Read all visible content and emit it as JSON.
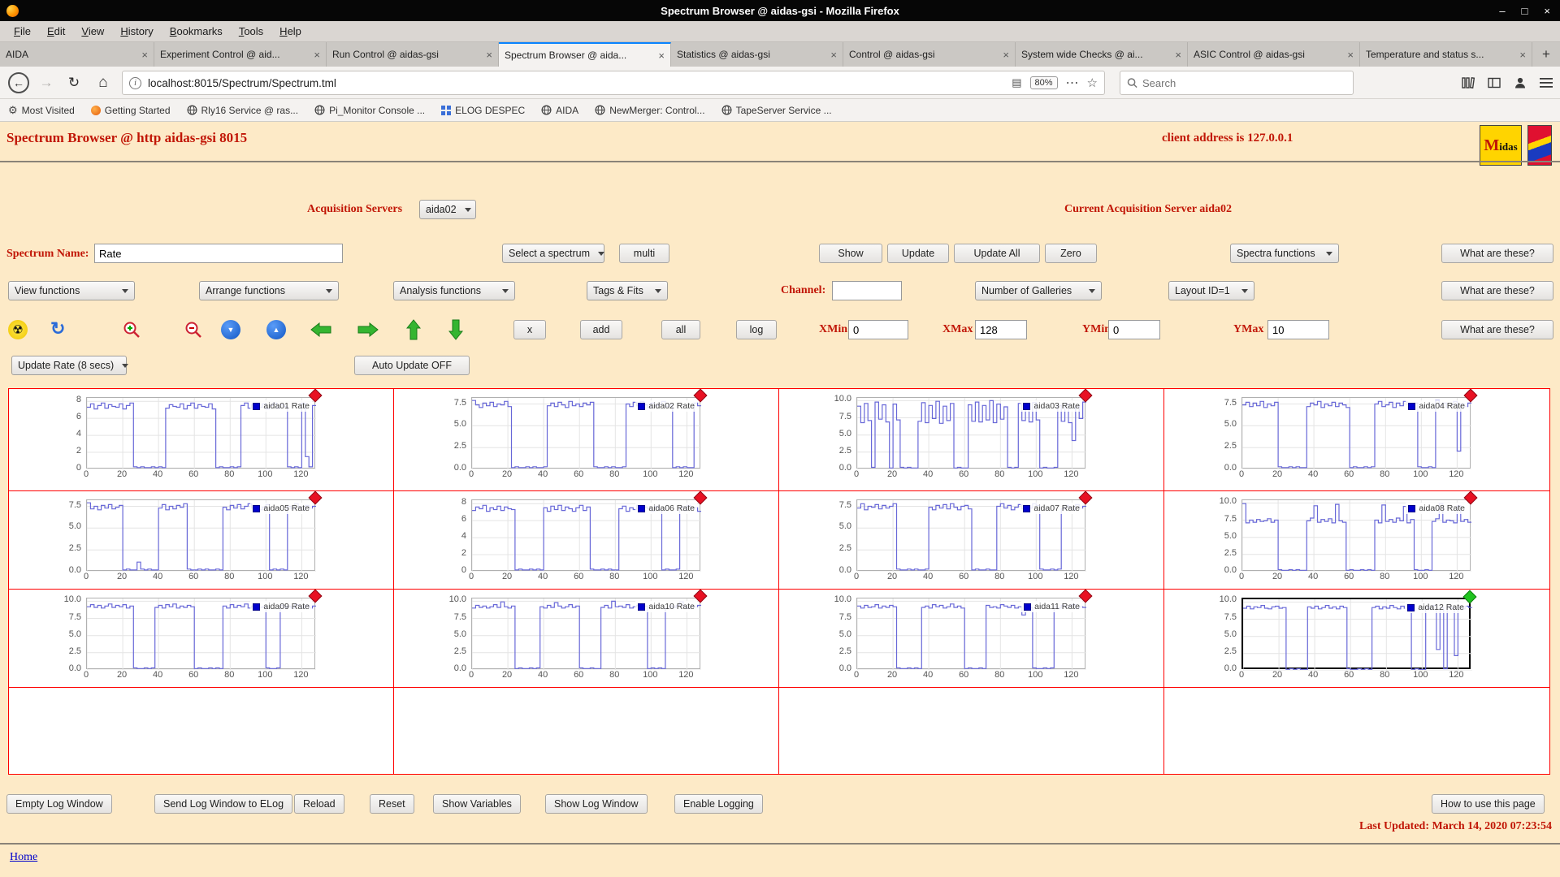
{
  "window": {
    "title": "Spectrum Browser @ aidas-gsi - Mozilla Firefox"
  },
  "menubar": [
    "File",
    "Edit",
    "View",
    "History",
    "Bookmarks",
    "Tools",
    "Help"
  ],
  "tabs": [
    {
      "label": "AIDA"
    },
    {
      "label": "Experiment Control @ aid..."
    },
    {
      "label": "Run Control @ aidas-gsi"
    },
    {
      "label": "Spectrum Browser @ aida...",
      "active": true
    },
    {
      "label": "Statistics @ aidas-gsi"
    },
    {
      "label": "Control @ aidas-gsi"
    },
    {
      "label": "System wide Checks @ ai..."
    },
    {
      "label": "ASIC Control @ aidas-gsi"
    },
    {
      "label": "Temperature and status s..."
    }
  ],
  "navbar": {
    "url": "localhost:8015/Spectrum/Spectrum.tml",
    "zoom": "80%",
    "search_placeholder": "Search"
  },
  "bookmarks": [
    "Most Visited",
    "Getting Started",
    "Rly16 Service @ ras...",
    "Pi_Monitor Console ...",
    "ELOG DESPEC",
    "AIDA",
    "NewMerger: Control...",
    "TapeServer Service ..."
  ],
  "page": {
    "title": "Spectrum Browser @ http aidas-gsi 8015",
    "client_address": "client address is 127.0.0.1",
    "midas_logo_text": "Midas",
    "acquisition_servers_label": "Acquisition Servers",
    "acquisition_server_value": "aida02",
    "current_server": "Current Acquisition Server aida02",
    "spectrum_name_label": "Spectrum Name:",
    "spectrum_name_value": "Rate",
    "select_spectrum": "Select a spectrum",
    "multi": "multi",
    "show": "Show",
    "update": "Update",
    "update_all": "Update All",
    "zero": "Zero",
    "spectra_functions": "Spectra functions",
    "what_are_these": "What are these?",
    "view_functions": "View functions",
    "arrange_functions": "Arrange functions",
    "analysis_functions": "Analysis functions",
    "tags_fits": "Tags & Fits",
    "channel_label": "Channel:",
    "number_of_galleries": "Number of Galleries",
    "layout_id": "Layout ID=1",
    "x_label": "x",
    "add_label": "add",
    "all_label": "all",
    "log_label": "log",
    "xmin_label": "XMin",
    "xmin_value": "0",
    "xmax_label": "XMax",
    "xmax_value": "128",
    "ymin_label": "YMin",
    "ymin_value": "0",
    "ymax_label": "YMax",
    "ymax_value": "10",
    "update_rate": "Update Rate (8 secs)",
    "auto_update": "Auto Update OFF",
    "footer_buttons": [
      "Empty Log Window",
      "Send Log Window to ELog",
      "Reload",
      "Reset",
      "Show Variables",
      "Show Log Window",
      "Enable Logging"
    ],
    "how_to_use": "How to use this page",
    "last_updated": "Last Updated: March 14, 2020 07:23:54",
    "home": "Home"
  },
  "chart_data": {
    "type": "line",
    "x_range": [
      0,
      128
    ],
    "x_step": 2,
    "xticks": [
      0,
      20,
      40,
      60,
      80,
      100,
      120
    ],
    "line_color": "#6868d8",
    "legend_square_color": "#0000cc",
    "marker_colors": {
      "red": "#e81123",
      "green": "#1fc41f"
    },
    "charts": [
      {
        "name": "aida01",
        "legend": "aida01 Rate",
        "marker": "red",
        "selected": false,
        "yticks": [
          "8",
          "6",
          "4",
          "2",
          "0"
        ],
        "ylim": [
          0,
          8.4
        ],
        "values": [
          7.3,
          7.7,
          7.1,
          7.5,
          7.8,
          7.2,
          7.6,
          7.4,
          7.3,
          7.7,
          7.1,
          7.5,
          7.8,
          0.3,
          0.2,
          0.3,
          0.2,
          0.2,
          0.3,
          0.2,
          0.3,
          0.2,
          7.2,
          7.6,
          7.4,
          7.3,
          7.7,
          7.1,
          7.5,
          7.8,
          7.2,
          7.6,
          7.4,
          7.3,
          7.7,
          7.1,
          0.2,
          0.3,
          0.2,
          0.2,
          0.3,
          0.2,
          0.3,
          7.5,
          7.8,
          7.2,
          7.6,
          7.4,
          7.3,
          7.7,
          7.1,
          7.5,
          7.8,
          7.2,
          7.6,
          7.4,
          0.3,
          0.2,
          0.3,
          0.2,
          7.8,
          1.5,
          0.3,
          7.5
        ]
      },
      {
        "name": "aida02",
        "legend": "aida02 Rate",
        "marker": "red",
        "selected": false,
        "yticks": [
          "7.5",
          "5.0",
          "2.5",
          "0.0"
        ],
        "ylim": [
          0,
          8.2
        ],
        "values": [
          7.9,
          7.4,
          7.1,
          7.6,
          7.3,
          7.7,
          7.2,
          7.5,
          7.4,
          7.8,
          7.2,
          0.2,
          0.3,
          0.2,
          0.2,
          0.3,
          0.2,
          0.3,
          0.2,
          0.2,
          0.3,
          7.3,
          7.6,
          7.2,
          7.7,
          7.4,
          7.1,
          7.8,
          7.3,
          7.5,
          7.2,
          7.6,
          7.4,
          7.7,
          0.3,
          0.2,
          0.2,
          0.3,
          0.2,
          0.3,
          0.2,
          0.2,
          0.3,
          7.5,
          7.2,
          7.7,
          7.3,
          7.8,
          7.4,
          7.1,
          7.6,
          7.3,
          7.5,
          7.8,
          7.2,
          7.4,
          0.2,
          0.3,
          0.2,
          0.3,
          0.2,
          0.2,
          7.6,
          7.3
        ]
      },
      {
        "name": "aida03",
        "legend": "aida03 Rate",
        "marker": "red",
        "selected": false,
        "yticks": [
          "10.0",
          "7.5",
          "5.0",
          "2.5",
          "0.0"
        ],
        "ylim": [
          0,
          10.4
        ],
        "values": [
          9.2,
          6.8,
          9.6,
          7.1,
          0.3,
          9.8,
          7.3,
          9.4,
          6.9,
          0.2,
          9.5,
          7.2,
          0.3,
          0.2,
          0.3,
          0.2,
          0.2,
          7.0,
          9.7,
          6.8,
          9.3,
          7.4,
          9.9,
          6.7,
          9.2,
          7.1,
          9.6,
          0.2,
          0.3,
          0.2,
          0.2,
          9.4,
          7.0,
          9.8,
          6.9,
          9.3,
          7.2,
          10.0,
          6.8,
          9.5,
          7.3,
          9.1,
          0.3,
          0.2,
          0.3,
          9.6,
          7.1,
          9.4,
          6.9,
          9.7,
          7.2,
          0.2,
          0.3,
          0.2,
          0.2,
          0.3,
          9.3,
          7.0,
          9.5,
          6.8,
          4.2,
          9.2,
          7.4,
          9.8
        ]
      },
      {
        "name": "aida04",
        "legend": "aida04 Rate",
        "marker": "red",
        "selected": false,
        "yticks": [
          "7.5",
          "5.0",
          "2.5",
          "0.0"
        ],
        "ylim": [
          0,
          8.2
        ],
        "values": [
          7.4,
          7.7,
          7.2,
          7.6,
          7.3,
          7.8,
          7.1,
          7.5,
          7.3,
          7.7,
          0.3,
          0.2,
          0.2,
          0.3,
          0.2,
          0.3,
          0.2,
          0.2,
          7.2,
          7.6,
          7.4,
          7.8,
          7.1,
          7.5,
          7.3,
          7.7,
          7.2,
          7.6,
          7.4,
          7.1,
          0.2,
          0.3,
          0.2,
          0.2,
          0.3,
          0.2,
          0.3,
          7.5,
          7.8,
          7.2,
          7.4,
          7.7,
          7.1,
          7.6,
          7.3,
          7.8,
          7.4,
          7.2,
          7.6,
          0.3,
          0.2,
          0.2,
          0.3,
          0.2,
          7.9,
          7.3,
          7.6,
          7.1,
          7.4,
          7.8,
          2.1,
          7.5,
          7.2,
          7.6
        ]
      },
      {
        "name": "aida05",
        "legend": "aida05 Rate",
        "marker": "red",
        "selected": false,
        "yticks": [
          "7.5",
          "5.0",
          "2.5",
          "0.0"
        ],
        "ylim": [
          0,
          8.2
        ],
        "values": [
          7.9,
          7.2,
          7.5,
          7.1,
          7.6,
          7.3,
          7.7,
          7.2,
          7.4,
          7.6,
          0.2,
          0.3,
          0.2,
          0.2,
          1.1,
          0.3,
          0.2,
          0.3,
          0.2,
          0.2,
          7.3,
          7.7,
          7.1,
          7.5,
          7.2,
          7.6,
          7.4,
          7.8,
          0.3,
          0.2,
          0.2,
          0.3,
          0.2,
          0.3,
          0.2,
          0.2,
          0.3,
          0.2,
          7.4,
          7.1,
          7.6,
          7.3,
          7.7,
          7.2,
          7.5,
          7.8,
          7.3,
          7.6,
          7.1,
          7.4,
          7.7,
          0.2,
          0.3,
          0.2,
          0.3,
          0.2,
          7.5,
          7.2,
          7.8,
          7.4,
          7.1,
          7.6,
          7.3,
          7.5
        ]
      },
      {
        "name": "aida06",
        "legend": "aida06 Rate",
        "marker": "red",
        "selected": false,
        "yticks": [
          "8",
          "6",
          "4",
          "2",
          "0"
        ],
        "ylim": [
          0,
          8.4
        ],
        "values": [
          7.2,
          7.6,
          7.4,
          7.8,
          7.1,
          7.5,
          7.3,
          7.7,
          7.2,
          7.6,
          7.4,
          7.3,
          0.2,
          0.3,
          0.2,
          0.2,
          0.3,
          0.2,
          0.3,
          0.2,
          7.5,
          7.1,
          7.7,
          7.3,
          7.8,
          7.2,
          7.6,
          7.4,
          7.1,
          7.5,
          7.8,
          7.2,
          7.6,
          0.3,
          0.2,
          0.2,
          0.3,
          0.2,
          0.3,
          0.2,
          0.2,
          7.4,
          7.7,
          7.1,
          7.5,
          7.3,
          7.8,
          7.2,
          7.6,
          7.4,
          7.1,
          7.7,
          7.3,
          0.2,
          0.3,
          0.2,
          0.2,
          0.3,
          7.6,
          7.2,
          7.8,
          7.4,
          7.5,
          7.1
        ]
      },
      {
        "name": "aida07",
        "legend": "aida07 Rate",
        "marker": "red",
        "selected": false,
        "yticks": [
          "7.5",
          "5.0",
          "2.5",
          "0.0"
        ],
        "ylim": [
          0,
          8.2
        ],
        "values": [
          7.3,
          7.8,
          7.1,
          7.5,
          7.4,
          7.7,
          7.2,
          7.6,
          7.3,
          7.5,
          7.8,
          0.3,
          0.2,
          0.2,
          0.3,
          0.2,
          0.3,
          0.2,
          0.2,
          0.3,
          7.4,
          7.1,
          7.6,
          7.3,
          7.7,
          7.2,
          7.8,
          7.4,
          7.1,
          7.5,
          7.6,
          7.2,
          0.2,
          0.3,
          0.2,
          0.2,
          0.3,
          0.2,
          0.2,
          7.5,
          7.8,
          7.3,
          7.6,
          7.1,
          7.4,
          7.7,
          7.2,
          7.5,
          7.3,
          7.8,
          7.6,
          0.3,
          0.2,
          0.2,
          0.3,
          0.2,
          0.3,
          7.2,
          7.6,
          7.4,
          7.1,
          7.7,
          7.3,
          7.5
        ]
      },
      {
        "name": "aida08",
        "legend": "aida08 Rate",
        "marker": "red",
        "selected": false,
        "yticks": [
          "10.0",
          "7.5",
          "5.0",
          "2.5",
          "0.0"
        ],
        "ylim": [
          0,
          10.4
        ],
        "values": [
          9.9,
          7.1,
          7.5,
          7.2,
          7.6,
          7.3,
          7.4,
          7.7,
          7.2,
          7.5,
          0.3,
          0.2,
          0.2,
          0.3,
          0.2,
          0.3,
          0.2,
          0.2,
          7.4,
          7.8,
          9.6,
          7.2,
          7.6,
          7.3,
          7.7,
          7.1,
          9.8,
          7.4,
          7.2,
          0.2,
          0.3,
          0.2,
          0.2,
          0.3,
          0.2,
          0.3,
          0.2,
          7.5,
          7.1,
          9.7,
          7.3,
          7.6,
          7.2,
          7.8,
          7.4,
          9.5,
          7.1,
          7.6,
          0.3,
          0.2,
          0.2,
          0.3,
          0.2,
          7.3,
          7.7,
          9.9,
          7.2,
          7.5,
          7.4,
          7.1,
          9.6,
          7.3,
          7.6,
          7.2
        ]
      },
      {
        "name": "aida09",
        "legend": "aida09 Rate",
        "marker": "red",
        "selected": false,
        "yticks": [
          "10.0",
          "7.5",
          "5.0",
          "2.5",
          "0.0"
        ],
        "ylim": [
          0,
          10.4
        ],
        "values": [
          9.2,
          9.5,
          9.1,
          9.4,
          9.0,
          9.3,
          9.6,
          9.1,
          9.4,
          9.2,
          9.5,
          9.0,
          9.3,
          0.3,
          0.2,
          0.2,
          0.3,
          0.2,
          0.3,
          9.1,
          9.4,
          9.0,
          9.5,
          9.2,
          9.6,
          9.0,
          9.3,
          9.1,
          9.4,
          9.2,
          0.2,
          0.3,
          0.2,
          0.2,
          0.3,
          0.2,
          0.3,
          0.2,
          9.3,
          9.0,
          9.5,
          9.1,
          9.4,
          9.2,
          9.6,
          9.0,
          9.3,
          9.5,
          9.1,
          9.2,
          0.3,
          0.2,
          0.2,
          0.3,
          9.4,
          9.1,
          9.3,
          9.0,
          9.5,
          9.2,
          9.1,
          9.4,
          9.0,
          9.3
        ]
      },
      {
        "name": "aida10",
        "legend": "aida10 Rate",
        "marker": "red",
        "selected": false,
        "yticks": [
          "10.0",
          "7.5",
          "5.0",
          "2.5",
          "0.0"
        ],
        "ylim": [
          0,
          10.4
        ],
        "values": [
          9.0,
          9.4,
          9.1,
          9.3,
          9.0,
          9.2,
          9.5,
          9.1,
          9.9,
          9.2,
          9.0,
          9.3,
          0.2,
          0.3,
          0.2,
          0.2,
          0.3,
          0.2,
          0.3,
          9.2,
          9.0,
          9.4,
          9.1,
          9.8,
          9.3,
          9.0,
          9.2,
          9.5,
          9.1,
          9.3,
          0.3,
          0.2,
          0.2,
          0.3,
          0.2,
          0.2,
          9.1,
          9.4,
          9.0,
          10.0,
          9.2,
          9.3,
          9.1,
          9.5,
          9.0,
          9.2,
          9.4,
          9.1,
          9.3,
          0.2,
          0.3,
          0.2,
          0.3,
          0.2,
          9.0,
          9.3,
          9.1,
          9.4,
          9.9,
          9.2,
          9.0,
          9.3,
          9.2,
          9.4
        ]
      },
      {
        "name": "aida11",
        "legend": "aida11 Rate",
        "marker": "red",
        "selected": false,
        "yticks": [
          "10.0",
          "7.5",
          "5.0",
          "2.5",
          "0.0"
        ],
        "ylim": [
          0,
          10.4
        ],
        "values": [
          9.3,
          9.0,
          9.4,
          9.1,
          9.2,
          9.5,
          9.0,
          9.3,
          9.1,
          9.4,
          9.2,
          0.3,
          0.2,
          0.2,
          0.3,
          0.2,
          0.3,
          0.2,
          9.1,
          9.3,
          9.0,
          9.5,
          9.2,
          9.4,
          9.0,
          9.2,
          9.6,
          9.1,
          9.3,
          9.0,
          0.2,
          0.3,
          0.2,
          0.2,
          0.3,
          0.2,
          9.4,
          9.1,
          9.2,
          9.0,
          9.5,
          9.3,
          9.1,
          9.4,
          9.0,
          9.2,
          8.0,
          9.3,
          9.1,
          0.3,
          0.2,
          0.2,
          0.3,
          0.2,
          0.3,
          9.2,
          9.0,
          9.4,
          9.1,
          9.3,
          9.5,
          9.0,
          9.2,
          9.1
        ]
      },
      {
        "name": "aida12",
        "legend": "aida12 Rate",
        "marker": "green",
        "selected": true,
        "yticks": [
          "10.0",
          "7.5",
          "5.0",
          "2.5",
          "0.0"
        ],
        "ylim": [
          0,
          10.4
        ],
        "values": [
          9.1,
          9.4,
          9.0,
          9.3,
          9.2,
          9.5,
          9.1,
          9.0,
          9.3,
          9.4,
          9.1,
          9.2,
          0.2,
          0.3,
          0.2,
          0.3,
          0.2,
          0.2,
          9.3,
          9.1,
          9.4,
          9.0,
          9.2,
          9.5,
          9.1,
          9.3,
          9.0,
          9.4,
          9.2,
          0.3,
          0.2,
          0.2,
          0.3,
          0.2,
          0.3,
          0.2,
          9.2,
          9.4,
          9.0,
          9.3,
          9.1,
          9.5,
          9.2,
          9.0,
          9.4,
          9.1,
          9.3,
          0.2,
          0.3,
          0.2,
          0.2,
          9.3,
          9.0,
          9.5,
          3.1,
          9.2,
          0.3,
          9.4,
          9.1,
          2.2,
          9.3,
          9.0,
          9.4,
          9.2
        ]
      }
    ]
  }
}
